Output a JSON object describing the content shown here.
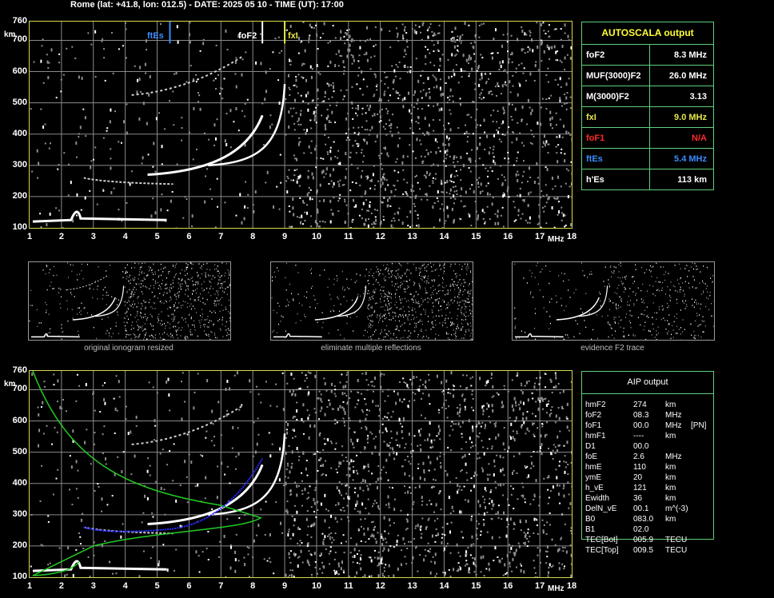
{
  "header": {
    "title": "Rome (lat: +41.8, lon: 012.5) - DATE: 2025 05 10 - TIME (UT): 17:00"
  },
  "ionogram": {
    "y_ticks": [
      "760",
      "700",
      "600",
      "500",
      "400",
      "300",
      "200",
      "100"
    ],
    "y_unit": "km",
    "x_ticks": [
      "1",
      "2",
      "3",
      "4",
      "5",
      "6",
      "7",
      "8",
      "9",
      "10",
      "11",
      "12",
      "13",
      "14",
      "15",
      "16",
      "17",
      "18"
    ],
    "x_unit": "MHz",
    "markers": {
      "ftEs": "ftEs",
      "foF2": "foF2",
      "fxI": "fxI"
    }
  },
  "autoscala": {
    "title": "AUTOSCALA output",
    "rows": [
      {
        "key": "foF2",
        "value": "8.3 MHz",
        "color": "#ffffff"
      },
      {
        "key": "MUF(3000)F2",
        "value": "26.0 MHz",
        "color": "#ffffff"
      },
      {
        "key": "M(3000)F2",
        "value": "3.13",
        "color": "#ffffff"
      },
      {
        "key": "fxI",
        "value": "9.0 MHz",
        "color": "#e6e64a"
      },
      {
        "key": "foF1",
        "value": "N/A",
        "color": "#ff2a2a"
      },
      {
        "key": "ftEs",
        "value": "5.4 MHz",
        "color": "#3a8cff"
      },
      {
        "key": "h'Es",
        "value": "113 km",
        "color": "#ffffff"
      }
    ]
  },
  "thumbnails": [
    {
      "caption": "original ionogram resized"
    },
    {
      "caption": "eliminate multiple reflections"
    },
    {
      "caption": "evidence F2 trace"
    }
  ],
  "aip": {
    "title": "AIP output",
    "rows": [
      {
        "key": "hmF2",
        "value": "274",
        "unit": "km",
        "extra": ""
      },
      {
        "key": "foF2",
        "value": "08.3",
        "unit": "MHz",
        "extra": ""
      },
      {
        "key": "foF1",
        "value": "00.0",
        "unit": "MHz",
        "extra": "[PN]"
      },
      {
        "key": "hmF1",
        "value": "----",
        "unit": "km",
        "extra": ""
      },
      {
        "key": "D1",
        "value": "00.0",
        "unit": "",
        "extra": ""
      },
      {
        "key": "foE",
        "value": "2.6",
        "unit": "MHz",
        "extra": ""
      },
      {
        "key": "hmE",
        "value": "110",
        "unit": "km",
        "extra": ""
      },
      {
        "key": "ymE",
        "value": "20",
        "unit": "km",
        "extra": ""
      },
      {
        "key": "h_vE",
        "value": "121",
        "unit": "km",
        "extra": ""
      },
      {
        "key": "Ewidth",
        "value": "36",
        "unit": "km",
        "extra": ""
      },
      {
        "key": "DelN_vE",
        "value": "00.1",
        "unit": "m^(-3)",
        "extra": ""
      },
      {
        "key": "B0",
        "value": "083.0",
        "unit": "km",
        "extra": ""
      },
      {
        "key": "B1",
        "value": "02.0",
        "unit": "",
        "extra": ""
      },
      {
        "key": "TEC[Bot]",
        "value": "005.9",
        "unit": "TECU",
        "extra": ""
      },
      {
        "key": "TEC[Top]",
        "value": "009.5",
        "unit": "TECU",
        "extra": ""
      }
    ]
  },
  "colors": {
    "frame": "#d8d84a",
    "grid": "#8a8a8a",
    "panel_border": "#5fd07a",
    "ftEs": "#3a8cff",
    "fxI": "#e6e64a",
    "model": "#22cc22"
  }
}
